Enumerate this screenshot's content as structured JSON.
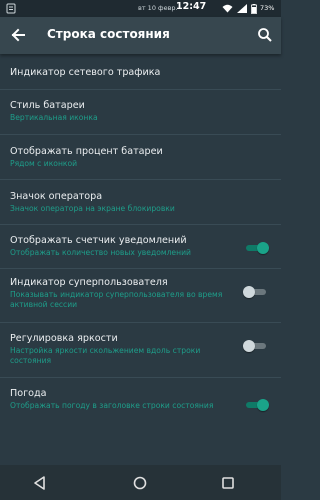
{
  "status_bar": {
    "date": "вт 10 февр.",
    "time": "12:47",
    "battery": "73%"
  },
  "toolbar": {
    "title": "Строка состояния"
  },
  "settings": [
    {
      "title": "Индикатор сетевого трафика"
    },
    {
      "title": "Стиль батареи",
      "subtitle": "Вертикальная иконка"
    },
    {
      "title": "Отображать процент батареи",
      "subtitle": "Рядом с иконкой"
    },
    {
      "title": "Значок оператора",
      "subtitle": "Значок оператора на экране блокировки"
    },
    {
      "title": "Отображать счетчик уведомлений",
      "subtitle": "Отображать количество новых уведомлений",
      "toggle": true
    },
    {
      "title": "Индикатор суперпользователя",
      "subtitle": "Показывать индикатор суперпользователя во время активной сессии",
      "toggle": false
    },
    {
      "title": "Регулировка яркости",
      "subtitle": "Настройка яркости скольжением вдоль строки состояния",
      "toggle": false
    },
    {
      "title": "Погода",
      "subtitle": "Отображать погоду в заголовке строки состояния",
      "toggle": true
    }
  ],
  "colors": {
    "background": "#2b3a43",
    "toolbar": "#37474f",
    "accent": "#1e9e8a"
  },
  "icons": {
    "toolbar_left": "back-arrow-icon",
    "toolbar_right": "search-icon",
    "nav": [
      "back-triangle-icon",
      "home-circle-icon",
      "recents-square-icon"
    ]
  }
}
